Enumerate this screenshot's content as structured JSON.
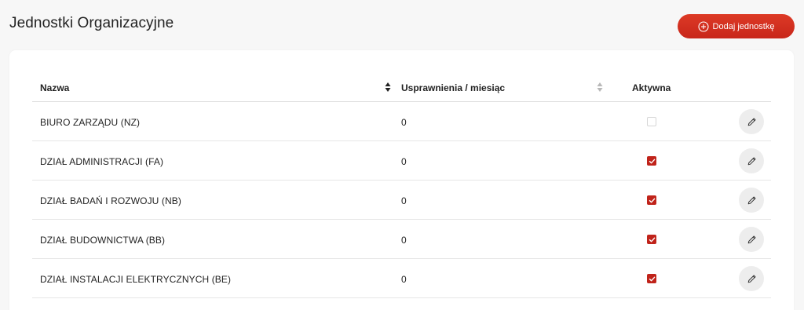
{
  "header": {
    "title": "Jednostki Organizacyjne",
    "add_button_label": "Dodaj jednostkę"
  },
  "table": {
    "columns": {
      "name": "Nazwa",
      "improvements": "Usprawnienia / miesiąc",
      "active": "Aktywna"
    },
    "rows": [
      {
        "name": "BIURO ZARZĄDU (NZ)",
        "improvements": "0",
        "active": false
      },
      {
        "name": "DZIAŁ ADMINISTRACJI (FA)",
        "improvements": "0",
        "active": true
      },
      {
        "name": "DZIAŁ BADAŃ I ROZWOJU (NB)",
        "improvements": "0",
        "active": true
      },
      {
        "name": "DZIAŁ BUDOWNICTWA (BB)",
        "improvements": "0",
        "active": true
      },
      {
        "name": "DZIAŁ INSTALACJI ELEKTRYCZNYCH (BE)",
        "improvements": "0",
        "active": true
      }
    ]
  },
  "colors": {
    "accent": "#c8261a",
    "checkbox_checked": "#c0231a"
  }
}
